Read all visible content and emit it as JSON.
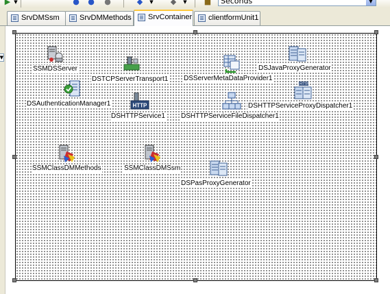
{
  "toolbar": {
    "combo_value": "Seconds",
    "icons": [
      "run-icon",
      "chevron-down-icon",
      "step-over-icon",
      "step-into-icon",
      "trace-icon",
      "back-icon",
      "chevron-down-icon",
      "forward-icon",
      "chevron-down-icon",
      "component-icon"
    ]
  },
  "tabs": [
    {
      "label": "SrvDMSsm",
      "active": false
    },
    {
      "label": "SrvDMMethods",
      "active": false
    },
    {
      "label": "SrvContainer",
      "active": true
    },
    {
      "label": "clientformUnit1",
      "active": false
    }
  ],
  "components": [
    {
      "name": "SSMDSServer",
      "icon": "server-icon"
    },
    {
      "name": "DSTCPServerTransport1",
      "icon": "transport-icon"
    },
    {
      "name": "DSServerMetaDataProvider1",
      "icon": "metadata-provider-icon"
    },
    {
      "name": "DSJavaProxyGenerator",
      "icon": "proxy-generator-icon"
    },
    {
      "name": "DSAuthenticationManager1",
      "icon": "authentication-icon"
    },
    {
      "name": "DSHTTPService1",
      "icon": "http-service-icon"
    },
    {
      "name": "DSHTTPServiceFileDispatcher1",
      "icon": "file-dispatcher-icon"
    },
    {
      "name": "DSHTTPServiceProxyDispatcher1",
      "icon": "proxy-dispatcher-icon"
    },
    {
      "name": "SSMClassDMMethods",
      "icon": "server-class-icon"
    },
    {
      "name": "SSMClassDMSsm",
      "icon": "server-class-icon"
    },
    {
      "name": "DSPasProxyGenerator",
      "icon": "proxy-generator-icon"
    }
  ]
}
